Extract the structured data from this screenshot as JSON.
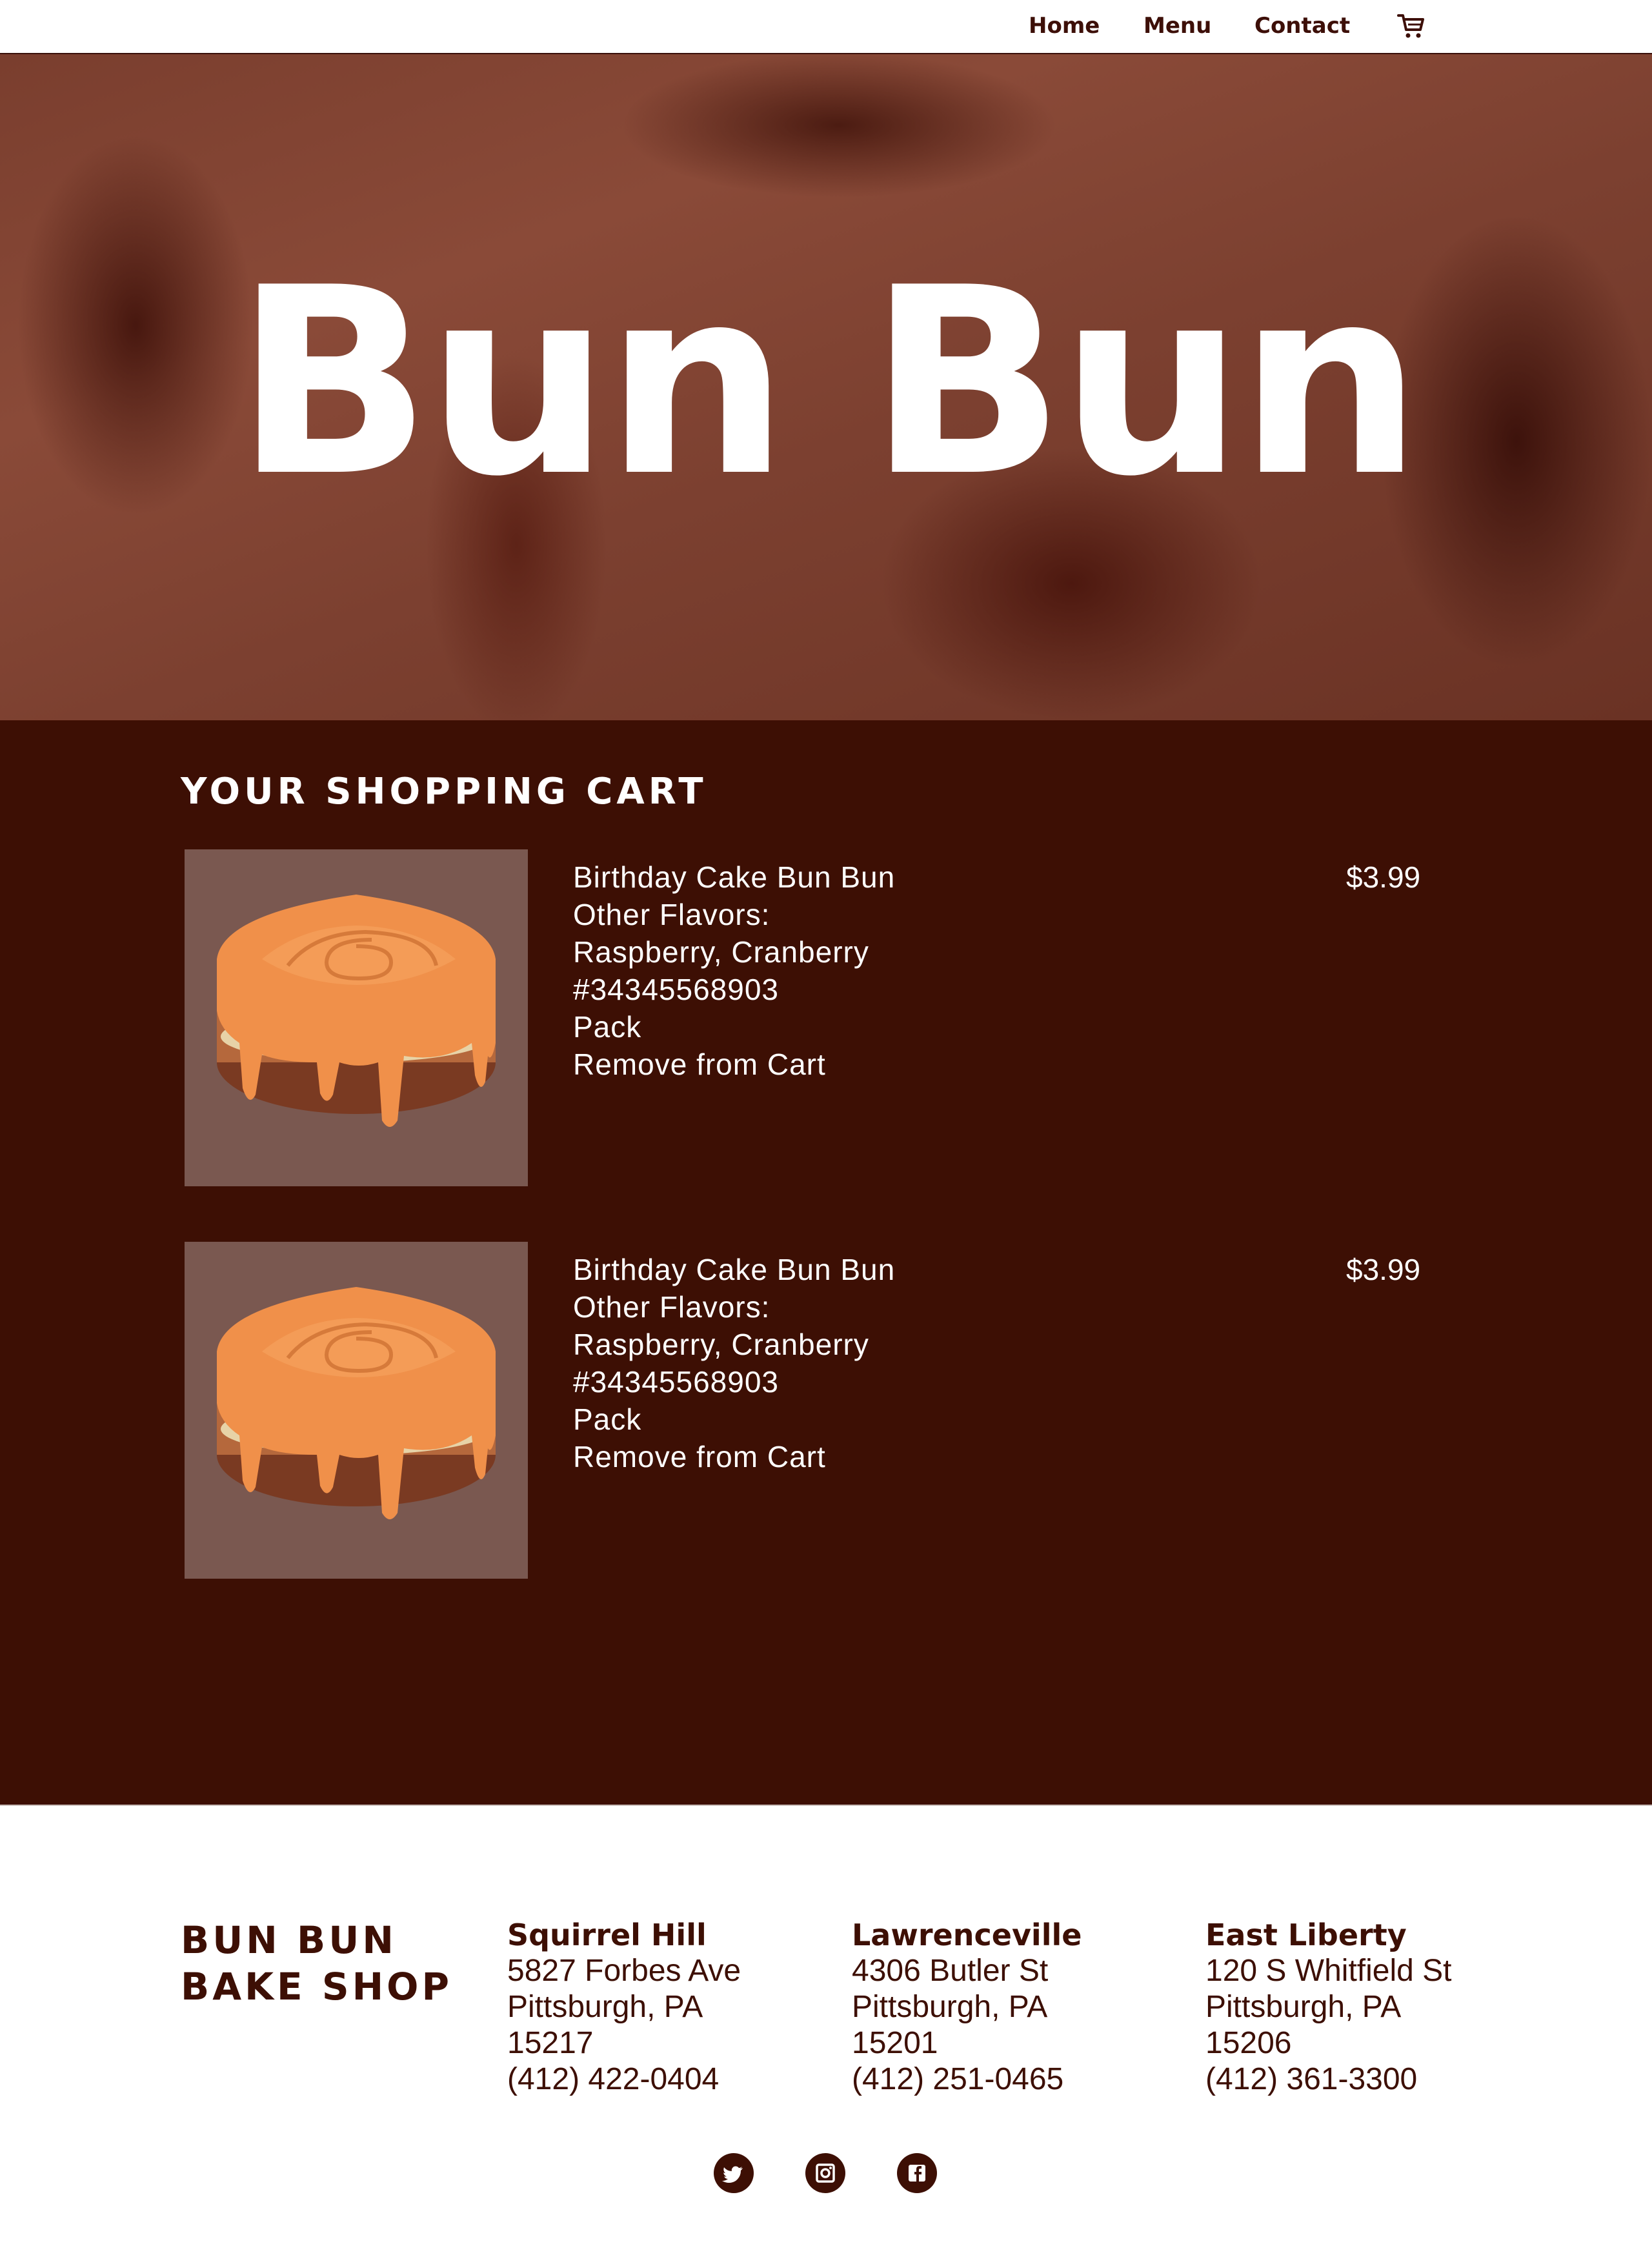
{
  "nav": {
    "home": "Home",
    "menu": "Menu",
    "contact": "Contact",
    "cart_icon": "shopping-cart-icon"
  },
  "hero": {
    "title": "Bun Bun"
  },
  "cart": {
    "heading": "YOUR SHOPPING CART",
    "items": [
      {
        "name": "Birthday Cake Bun Bun",
        "other_flavors_label": "Other Flavors:",
        "other_flavors": "Raspberry, Cranberry",
        "sku": "#34345568903",
        "pack": "Pack",
        "remove": "Remove from Cart",
        "price": "$3.99"
      },
      {
        "name": "Birthday Cake Bun Bun",
        "other_flavors_label": "Other Flavors:",
        "other_flavors": "Raspberry, Cranberry",
        "sku": "#34345568903",
        "pack": "Pack",
        "remove": "Remove from Cart",
        "price": "$3.99"
      }
    ]
  },
  "footer": {
    "brand_line1": "BUN BUN",
    "brand_line2": "BAKE SHOP",
    "locations": [
      {
        "name": "Squirrel Hill",
        "street": "5827 Forbes Ave",
        "city": "Pittsburgh, PA",
        "zip": "15217",
        "phone": "(412) 422-0404"
      },
      {
        "name": "Lawrenceville",
        "street": "4306 Butler St",
        "city": "Pittsburgh, PA",
        "zip": "15201",
        "phone": "(412) 251-0465"
      },
      {
        "name": "East Liberty",
        "street": "120 S Whitfield St",
        "city": "Pittsburgh, PA",
        "zip": "15206",
        "phone": "(412) 361-3300"
      }
    ],
    "social": [
      "twitter-icon",
      "instagram-icon",
      "facebook-icon"
    ]
  },
  "colors": {
    "brand_dark": "#3d0f04",
    "thumb_bg": "#7a5850",
    "icing": "#f0904a",
    "text_light": "#ffffff"
  }
}
